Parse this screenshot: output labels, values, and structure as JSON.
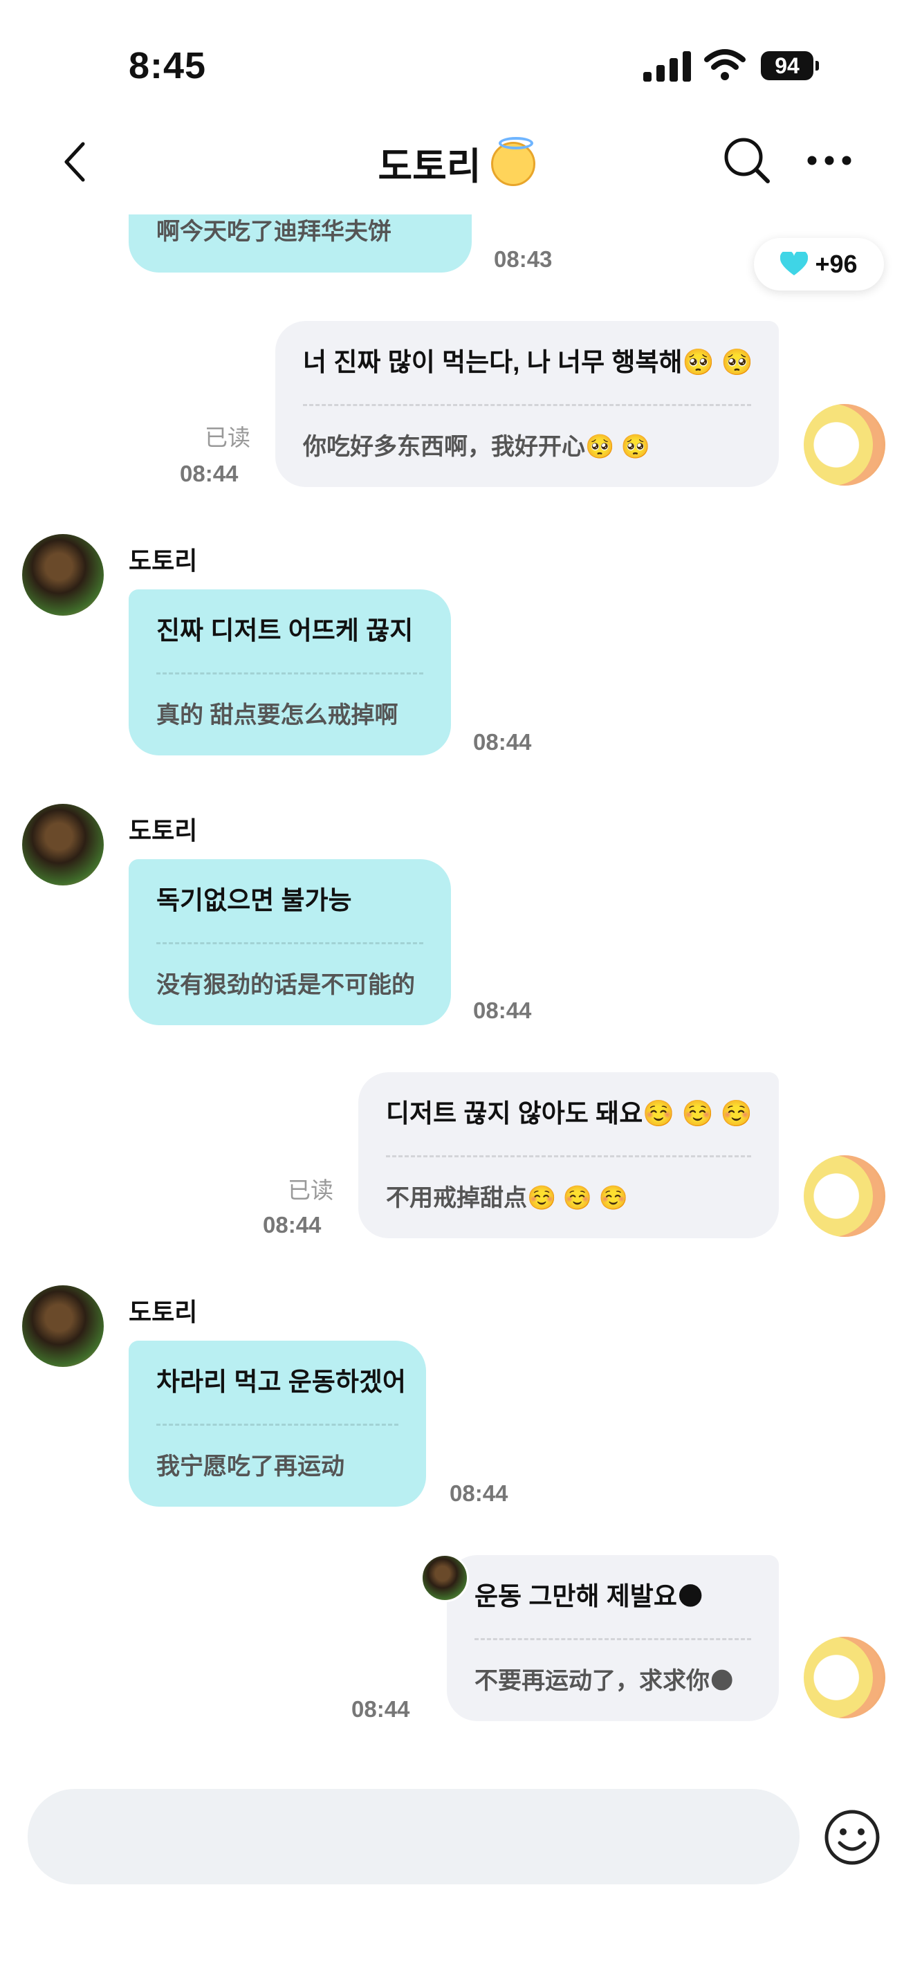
{
  "status_bar": {
    "time": "8:45",
    "battery": "94"
  },
  "header": {
    "title": "도토리",
    "title_emoji": "smiling-halo-emoji"
  },
  "likes": {
    "count": "+96",
    "icon": "cyan-heart-icon"
  },
  "messages": [
    {
      "side": "other",
      "original": "",
      "translation": "啊今天吃了迪拜华夫饼",
      "time": "08:43"
    },
    {
      "side": "mine",
      "original": "너 진짜 많이 먹는다, 나 너무 행복해🥺 🥺",
      "translation": "你吃好多东西啊，我好开心🥺 🥺",
      "read": "已读",
      "time": "08:44"
    },
    {
      "side": "other",
      "sender": "도토리",
      "original": "진짜 디저트 어뜨케 끊지",
      "translation": "真的 甜点要怎么戒掉啊",
      "time": "08:44"
    },
    {
      "side": "other",
      "sender": "도토리",
      "original": "독기없으면 불가능",
      "translation": "没有狠劲的话是不可能的",
      "time": "08:44"
    },
    {
      "side": "mine",
      "original": "디저트 끊지 않아도 돼요☺️ ☺️ ☺️",
      "translation": "不用戒掉甜点☺️ ☺️ ☺️",
      "read": "已读",
      "time": "08:44"
    },
    {
      "side": "other",
      "sender": "도토리",
      "original": "차라리 먹고 운동하겠어",
      "translation": "我宁愿吃了再运动",
      "time": "08:44"
    },
    {
      "side": "mine",
      "original": "운동 그만해 제발요🌑",
      "translation": "不要再运动了，求求你🌑",
      "time": "08:44"
    }
  ],
  "input": {
    "placeholder": ""
  },
  "colors": {
    "other_bubble": "#b9eff2",
    "mine_bubble": "#f1f2f6",
    "accent_heart": "#3fd5e6"
  }
}
